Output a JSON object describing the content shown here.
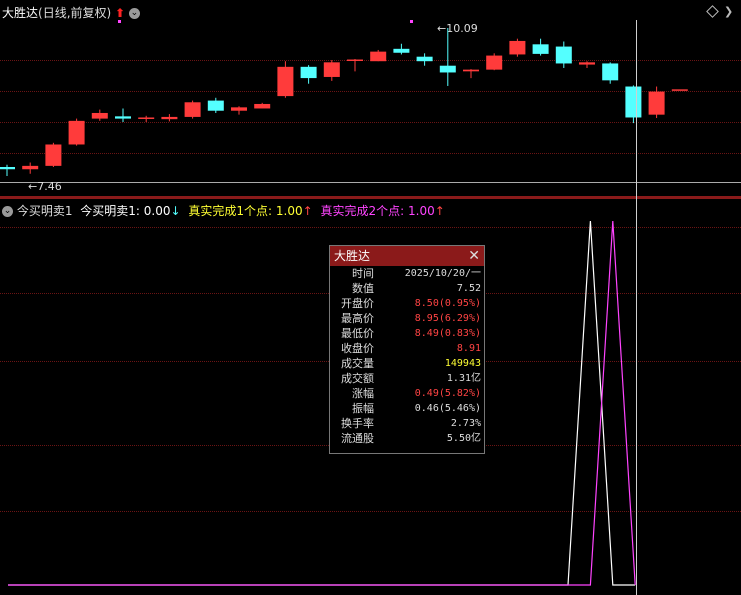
{
  "window": {
    "title": "大胜达",
    "period": "(日线,前复权)"
  },
  "colors": {
    "up": "#ff3b3b",
    "down": "#54ffff",
    "indicator1": "#ffffff",
    "indicator2": "#ff44ff",
    "yellow": "#ffff33"
  },
  "price_panel": {
    "high_label": "10.09",
    "low_label": "7.46"
  },
  "indicator_panel": {
    "name": "今买明卖1",
    "line1": "今买明卖1: 0.00",
    "line1_arrow": "↓",
    "line2": "真实完成1个点: 1.00",
    "line2_arrow": "↑",
    "line3": "真实完成2个点: 1.00",
    "line3_arrow": "↑"
  },
  "tooltip": {
    "title": "大胜达",
    "close_icon": "close-icon",
    "rows": [
      {
        "k": "时间",
        "v": "2025/10/20/一",
        "c": "#dddddd"
      },
      {
        "k": "数值",
        "v": "7.52",
        "c": "#dddddd"
      },
      {
        "k": "开盘价",
        "v": "8.50(0.95%)",
        "c": "#ff4444"
      },
      {
        "k": "最高价",
        "v": "8.95(6.29%)",
        "c": "#ff4444"
      },
      {
        "k": "最低价",
        "v": "8.49(0.83%)",
        "c": "#ff4444"
      },
      {
        "k": "收盘价",
        "v": "8.91",
        "c": "#ff4444"
      },
      {
        "k": "成交量",
        "v": "149943",
        "c": "#ffff33"
      },
      {
        "k": "成交额",
        "v": "1.31亿",
        "c": "#dddddd"
      },
      {
        "k": "涨幅",
        "v": "0.49(5.82%)",
        "c": "#ff4444"
      },
      {
        "k": "振幅",
        "v": "0.46(5.46%)",
        "c": "#dddddd"
      },
      {
        "k": "换手率",
        "v": "2.73%",
        "c": "#dddddd"
      },
      {
        "k": "流通股",
        "v": "5.50亿",
        "c": "#dddddd"
      }
    ]
  },
  "chart_data": [
    {
      "type": "candlestick",
      "title": "大胜达(日线,前复权)",
      "ylim": [
        7.3,
        10.3
      ],
      "candles": [
        {
          "o": 7.62,
          "h": 7.66,
          "l": 7.46,
          "c": 7.58
        },
        {
          "o": 7.58,
          "h": 7.7,
          "l": 7.5,
          "c": 7.64
        },
        {
          "o": 7.64,
          "h": 8.05,
          "l": 7.62,
          "c": 8.02
        },
        {
          "o": 8.02,
          "h": 8.48,
          "l": 8.0,
          "c": 8.44
        },
        {
          "o": 8.48,
          "h": 8.64,
          "l": 8.44,
          "c": 8.58
        },
        {
          "o": 8.52,
          "h": 8.66,
          "l": 8.42,
          "c": 8.48
        },
        {
          "o": 8.48,
          "h": 8.53,
          "l": 8.42,
          "c": 8.5
        },
        {
          "o": 8.47,
          "h": 8.56,
          "l": 8.43,
          "c": 8.51
        },
        {
          "o": 8.51,
          "h": 8.8,
          "l": 8.48,
          "c": 8.77
        },
        {
          "o": 8.8,
          "h": 8.85,
          "l": 8.58,
          "c": 8.62
        },
        {
          "o": 8.62,
          "h": 8.7,
          "l": 8.55,
          "c": 8.68
        },
        {
          "o": 8.66,
          "h": 8.76,
          "l": 8.66,
          "c": 8.74
        },
        {
          "o": 8.88,
          "h": 9.5,
          "l": 8.85,
          "c": 9.4
        },
        {
          "o": 9.4,
          "h": 9.43,
          "l": 9.1,
          "c": 9.2
        },
        {
          "o": 9.22,
          "h": 9.52,
          "l": 9.15,
          "c": 9.48
        },
        {
          "o": 9.52,
          "h": 9.54,
          "l": 9.32,
          "c": 9.53
        },
        {
          "o": 9.5,
          "h": 9.7,
          "l": 9.5,
          "c": 9.67
        },
        {
          "o": 9.72,
          "h": 9.81,
          "l": 9.62,
          "c": 9.65
        },
        {
          "o": 9.58,
          "h": 9.64,
          "l": 9.42,
          "c": 9.5
        },
        {
          "o": 9.42,
          "h": 10.09,
          "l": 9.06,
          "c": 9.3
        },
        {
          "o": 9.32,
          "h": 9.36,
          "l": 9.2,
          "c": 9.35
        },
        {
          "o": 9.35,
          "h": 9.64,
          "l": 9.34,
          "c": 9.6
        },
        {
          "o": 9.62,
          "h": 9.9,
          "l": 9.58,
          "c": 9.86
        },
        {
          "o": 9.8,
          "h": 9.9,
          "l": 9.6,
          "c": 9.63
        },
        {
          "o": 9.76,
          "h": 9.85,
          "l": 9.38,
          "c": 9.46
        },
        {
          "o": 9.44,
          "h": 9.5,
          "l": 9.38,
          "c": 9.48
        },
        {
          "o": 9.46,
          "h": 9.48,
          "l": 9.1,
          "c": 9.16
        },
        {
          "o": 9.05,
          "h": 9.07,
          "l": 8.4,
          "c": 8.5
        },
        {
          "o": 8.55,
          "h": 9.05,
          "l": 8.49,
          "c": 8.96
        },
        {
          "o": 9.0,
          "h": 9.0,
          "l": 9.0,
          "c": 9.0
        }
      ]
    },
    {
      "type": "line",
      "series": [
        {
          "name": "真实完成1个点",
          "values": [
            0,
            0,
            0,
            0,
            0,
            0,
            0,
            0,
            0,
            0,
            0,
            0,
            0,
            0,
            0,
            0,
            0,
            0,
            0,
            0,
            0,
            0,
            0,
            0,
            0,
            0,
            1,
            0,
            0
          ]
        },
        {
          "name": "真实完成2个点",
          "values": [
            0,
            0,
            0,
            0,
            0,
            0,
            0,
            0,
            0,
            0,
            0,
            0,
            0,
            0,
            0,
            0,
            0,
            0,
            0,
            0,
            0,
            0,
            0,
            0,
            0,
            0,
            0,
            1,
            0
          ]
        }
      ],
      "ylim": [
        0,
        1
      ]
    }
  ]
}
